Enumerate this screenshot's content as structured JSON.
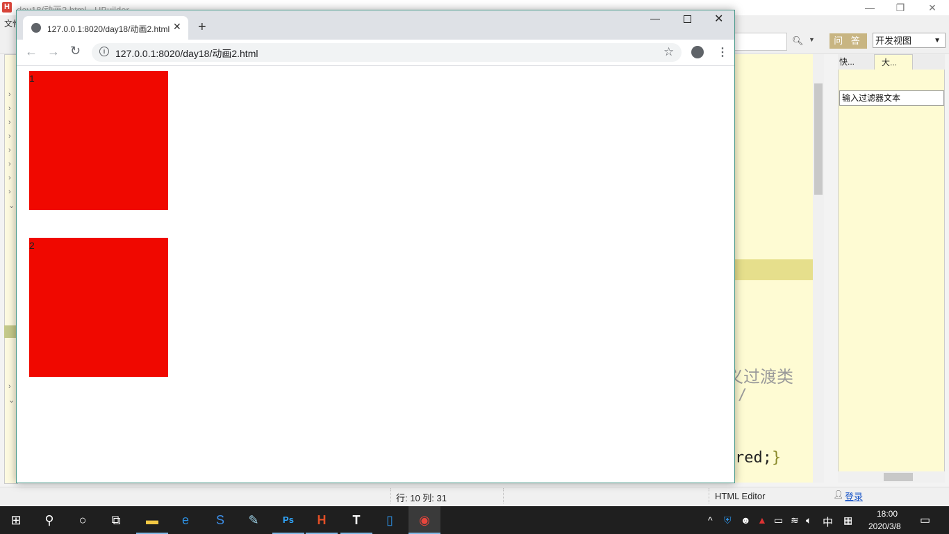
{
  "hbuilder": {
    "title": "day18/动画2.html - HBuilder",
    "menu_file": "文件",
    "ask_button": "问 答",
    "view_select": "开发视图",
    "editor_comment": "义过渡类",
    "editor_slash": "/",
    "editor_code": "red;",
    "editor_brace": "}",
    "tab_quick": "快...",
    "tab_outline": "大...",
    "filter_placeholder": "输入过滤器文本",
    "status_position": "行: 10 列: 31",
    "status_editor": "HTML Editor",
    "login": "登录"
  },
  "chrome": {
    "tab_title": "127.0.0.1:8020/day18/动画2.html",
    "url": "127.0.0.1:8020/day18/动画2.html",
    "new_tab": "+",
    "page": {
      "boxes": [
        {
          "label": "1",
          "color": "#f00800"
        },
        {
          "label": "2",
          "color": "#f00800"
        }
      ]
    }
  },
  "taskbar": {
    "time": "18:00",
    "date": "2020/3/8",
    "ime": "中",
    "apps": [
      "start-icon",
      "search-icon",
      "cortana-icon",
      "task-view-icon",
      "file-explorer-icon",
      "edge-icon",
      "sogou-browser-icon",
      "notepad-icon",
      "photoshop-icon",
      "hbuilder-icon",
      "typora-icon",
      "phone-icon",
      "chrome-icon"
    ]
  },
  "colors": {
    "accent_red": "#f00800",
    "editor_bg": "#fefbd3",
    "hbuilder_brand": "#d8453a"
  }
}
